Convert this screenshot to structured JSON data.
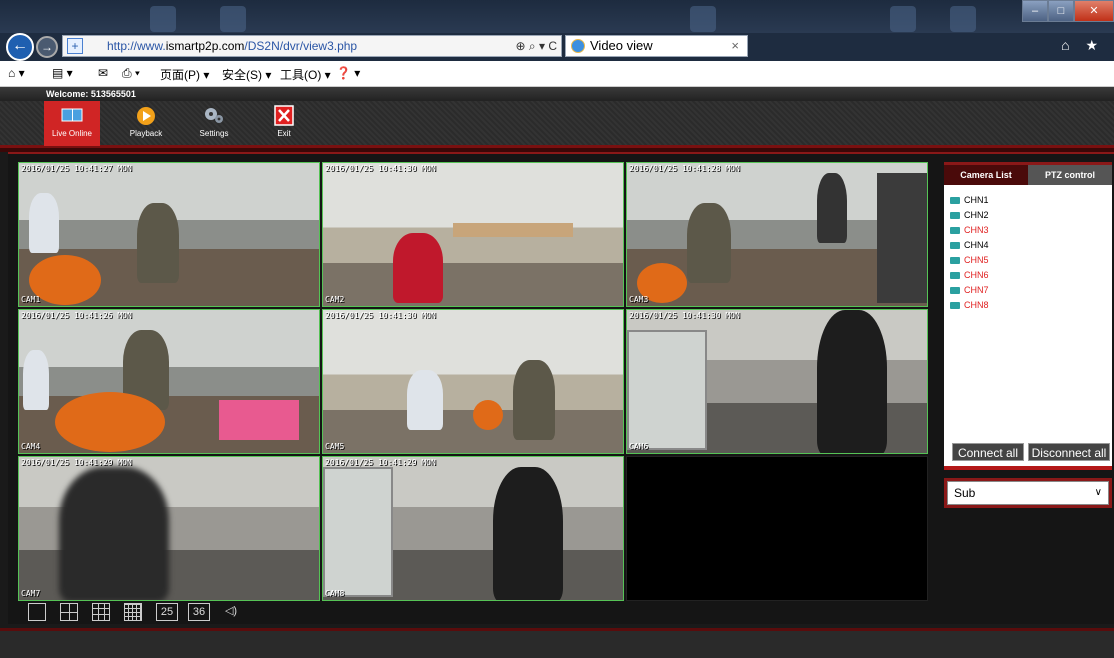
{
  "browser": {
    "url_prefix": "http://www.",
    "url_domain": "ismartp2p.com",
    "url_path": "/DS2N/dvr/view3.php",
    "tab_title": "Video view",
    "address_controls": "⊕ ⌕ ▾ C",
    "tab_close": "×",
    "window_buttons": [
      "–",
      "□",
      "✕"
    ],
    "right_icons": "⌂ ★",
    "menu_items": [
      "页面(P) ▾",
      "安全(S) ▾",
      "工具(O) ▾",
      "❓ ▾"
    ],
    "cmd_icons": [
      "⌂ ▾",
      "▤ ▾",
      "✉",
      "⎙ ▾"
    ]
  },
  "app": {
    "welcome": "Welcome: 513565501",
    "toolbar": [
      {
        "label": "Live Online",
        "icon": "monitor-icon"
      },
      {
        "label": "Playback",
        "icon": "play-icon"
      },
      {
        "label": "Settings",
        "icon": "gears-icon"
      },
      {
        "label": "Exit",
        "icon": "close-icon"
      }
    ],
    "cells": [
      {
        "osd": "2016/01/25 10:41:27 MON",
        "ch": "CAM1"
      },
      {
        "osd": "2016/01/25 10:41:30 MON",
        "ch": "CAM2"
      },
      {
        "osd": "2016/01/25 10:41:28 MON",
        "ch": "CAM3"
      },
      {
        "osd": "2016/01/25 10:41:26 MON",
        "ch": "CAM4"
      },
      {
        "osd": "2016/01/25 10:41:30 MON",
        "ch": "CAM5"
      },
      {
        "osd": "2016/01/25 10:41:30 MON",
        "ch": "CAM6"
      },
      {
        "osd": "2016/01/25 10:41:29 MON",
        "ch": "CAM7"
      },
      {
        "osd": "2016/01/25 10:41:29 MON",
        "ch": "CAM8"
      }
    ],
    "layout_buttons": [
      "",
      "",
      "",
      "",
      "25",
      "36",
      "◁)"
    ],
    "panel": {
      "tab_camera": "Camera List",
      "tab_ptz": "PTZ control",
      "channels": [
        {
          "name": "CHN1",
          "color": "#000000"
        },
        {
          "name": "CHN2",
          "color": "#000000"
        },
        {
          "name": "CHN3",
          "color": "#e02020"
        },
        {
          "name": "CHN4",
          "color": "#000000"
        },
        {
          "name": "CHN5",
          "color": "#e02020"
        },
        {
          "name": "CHN6",
          "color": "#e02020"
        },
        {
          "name": "CHN7",
          "color": "#e02020"
        },
        {
          "name": "CHN8",
          "color": "#e02020"
        }
      ],
      "connect_all": "Connect all",
      "disconnect_all": "Disconnect all"
    },
    "stream_select": "Sub",
    "stream_arrow": "∨"
  }
}
